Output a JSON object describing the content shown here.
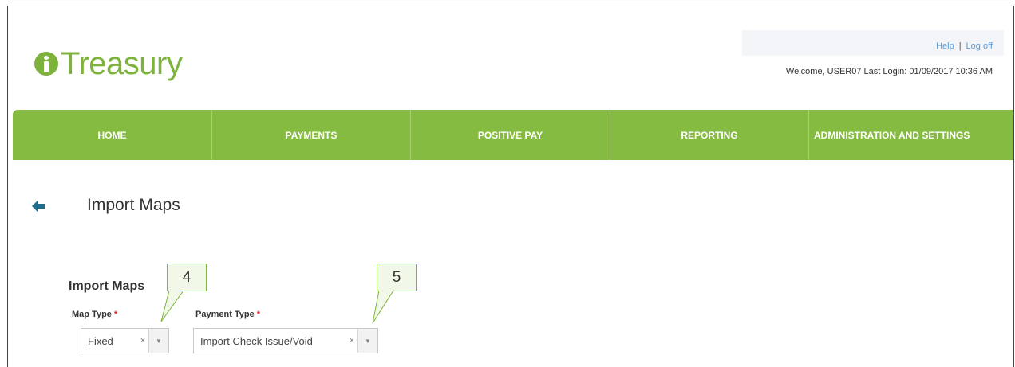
{
  "app": {
    "logo_text": "Treasury"
  },
  "header": {
    "help_label": "Help",
    "separator": "|",
    "logoff_label": "Log off",
    "welcome_text": "Welcome, USER07 Last Login: 01/09/2017 10:36 AM"
  },
  "nav": {
    "items": [
      {
        "label": "HOME"
      },
      {
        "label": "PAYMENTS"
      },
      {
        "label": "POSITIVE PAY"
      },
      {
        "label": "REPORTING"
      },
      {
        "label": "ADMINISTRATION AND SETTINGS"
      }
    ]
  },
  "page": {
    "title": "Import Maps",
    "section_title": "Import Maps"
  },
  "form": {
    "map_type": {
      "label": "Map Type",
      "required_mark": "*",
      "value": "Fixed",
      "clear_glyph": "×",
      "arrow_glyph": "▼"
    },
    "payment_type": {
      "label": "Payment Type",
      "required_mark": "*",
      "value": "Import Check Issue/Void",
      "clear_glyph": "×",
      "arrow_glyph": "▼"
    }
  },
  "callouts": [
    {
      "label": "4"
    },
    {
      "label": "5"
    }
  ],
  "colors": {
    "brand_green": "#86bb42",
    "link_blue": "#5a9bd5",
    "required_red": "#e0262b",
    "back_arrow": "#1f6e8c"
  }
}
